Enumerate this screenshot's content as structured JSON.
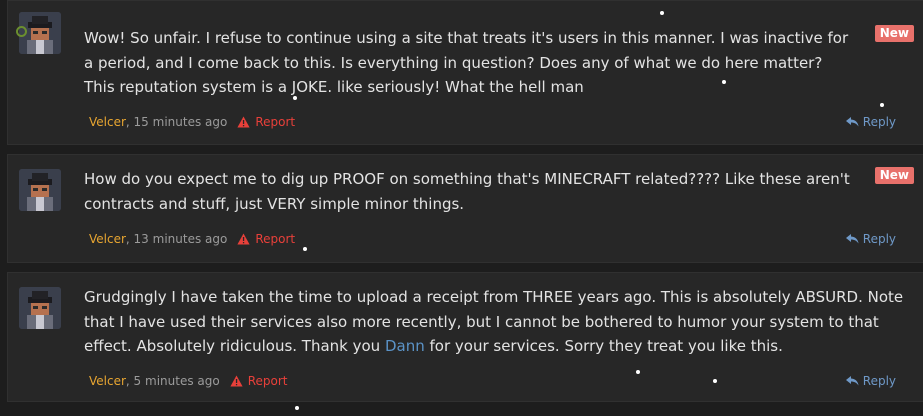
{
  "posts": [
    {
      "text": "Wow! So unfair. I refuse to continue using a site that treats it's users in this manner. I was inactive for a period, and I come back to this. Is everything in question? Does any of what we do here matter? This reputation system is a JOKE. like seriously! What the hell man",
      "badge": "New",
      "author": "Velcer",
      "time": ", 15 minutes ago",
      "report": "Report",
      "reply": "Reply"
    },
    {
      "text": "How do you expect me to dig up PROOF on something that's MINECRAFT related???? Like these aren't contracts and stuff, just VERY simple minor things.",
      "badge": "New",
      "author": "Velcer",
      "time": ", 13 minutes ago",
      "report": "Report",
      "reply": "Reply"
    },
    {
      "text_before": "Grudgingly I have taken the time to upload a receipt from THREE years ago. This is absolutely ABSURD. Note that I have used their services also more recently, but I cannot be bothered to humor your system to that effect. Absolutely ridiculous. Thank you ",
      "mention": "Dann",
      "text_after": " for your services. Sorry they treat you like this.",
      "author": "Velcer",
      "time": ", 5 minutes ago",
      "report": "Report",
      "reply": "Reply"
    }
  ],
  "colors": {
    "background": "#1d1d1d",
    "post_background": "#272727",
    "text": "#e3e3e3",
    "author": "#e7a531",
    "report": "#e8403a",
    "reply": "#6f99c8",
    "badge": "#e8716b",
    "mention": "#5b93c7"
  },
  "icons": {
    "report": "warning-triangle-icon",
    "reply": "reply-arrow-icon"
  }
}
